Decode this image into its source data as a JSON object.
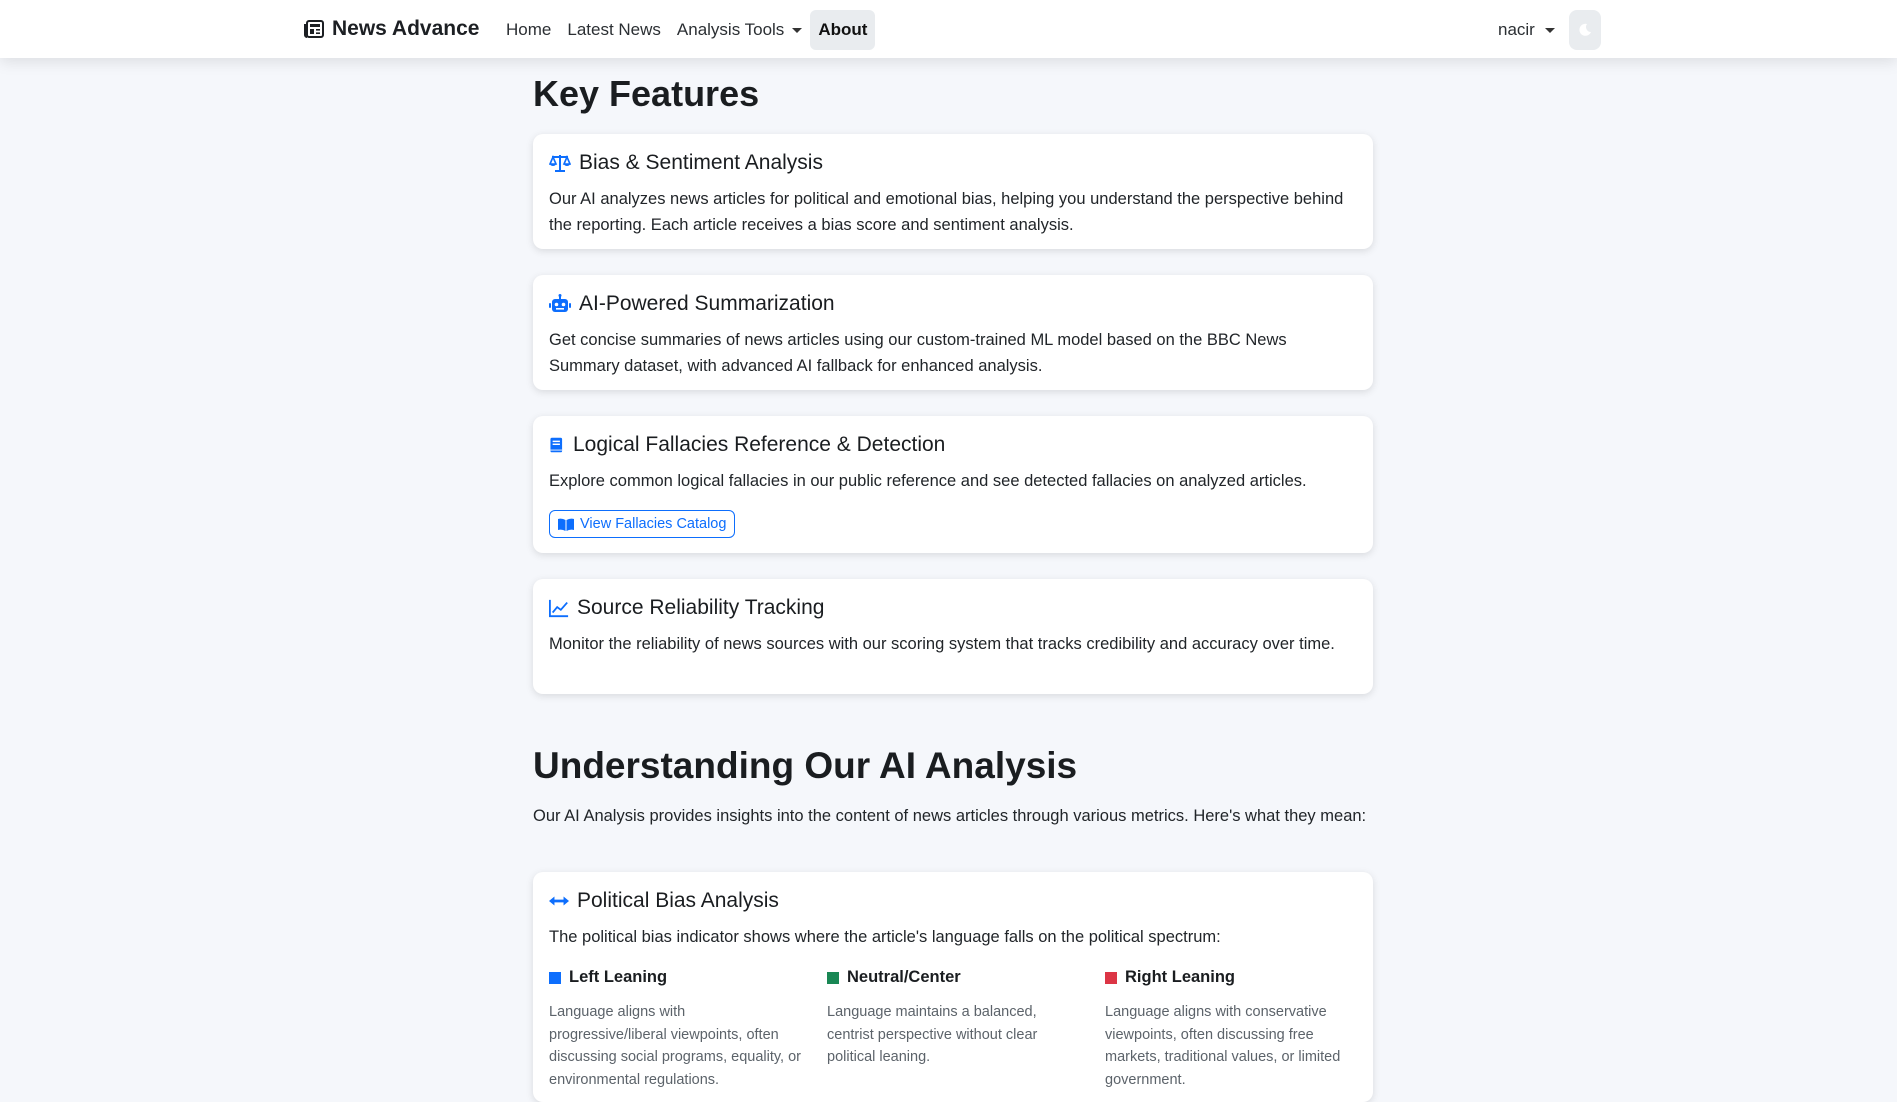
{
  "navbar": {
    "brand": "News Advance",
    "links": [
      {
        "label": "Home"
      },
      {
        "label": "Latest News"
      },
      {
        "label": "Analysis Tools"
      },
      {
        "label": "About"
      }
    ],
    "user": "nacir"
  },
  "key_features": {
    "title": "Key Features",
    "cards": [
      {
        "icon": "scale-icon",
        "title": "Bias & Sentiment Analysis",
        "text": "Our AI analyzes news articles for political and emotional bias, helping you understand the perspective behind the reporting. Each article receives a bias score and sentiment analysis."
      },
      {
        "icon": "robot-icon",
        "title": "AI-Powered Summarization",
        "text": "Get concise summaries of news articles using our custom-trained ML model based on the BBC News Summary dataset, with advanced AI fallback for enhanced analysis."
      },
      {
        "icon": "book-icon",
        "title": "Logical Fallacies Reference & Detection",
        "text": "Explore common logical fallacies in our public reference and see detected fallacies on analyzed articles.",
        "button": "View Fallacies Catalog"
      },
      {
        "icon": "chart-line-icon",
        "title": "Source Reliability Tracking",
        "text": "Monitor the reliability of news sources with our scoring system that tracks credibility and accuracy over time."
      }
    ]
  },
  "ai_analysis": {
    "title": "Understanding Our AI Analysis",
    "intro": "Our AI Analysis provides insights into the content of news articles through various metrics. Here's what they mean:",
    "political_card": {
      "title": "Political Bias Analysis",
      "text": "The political bias indicator shows where the article's language falls on the political spectrum:",
      "columns": [
        {
          "label": "Left Leaning",
          "color": "#0d6efd",
          "desc": "Language aligns with progressive/liberal viewpoints, often discussing social programs, equality, or environmental regulations."
        },
        {
          "label": "Neutral/Center",
          "color": "#198754",
          "desc": "Language maintains a balanced, centrist perspective without clear political leaning."
        },
        {
          "label": "Right Leaning",
          "color": "#dc3545",
          "desc": "Language aligns with conservative viewpoints, often discussing free markets, traditional values, or limited government."
        }
      ]
    }
  },
  "colors": {
    "accent": "#0d6efd"
  }
}
